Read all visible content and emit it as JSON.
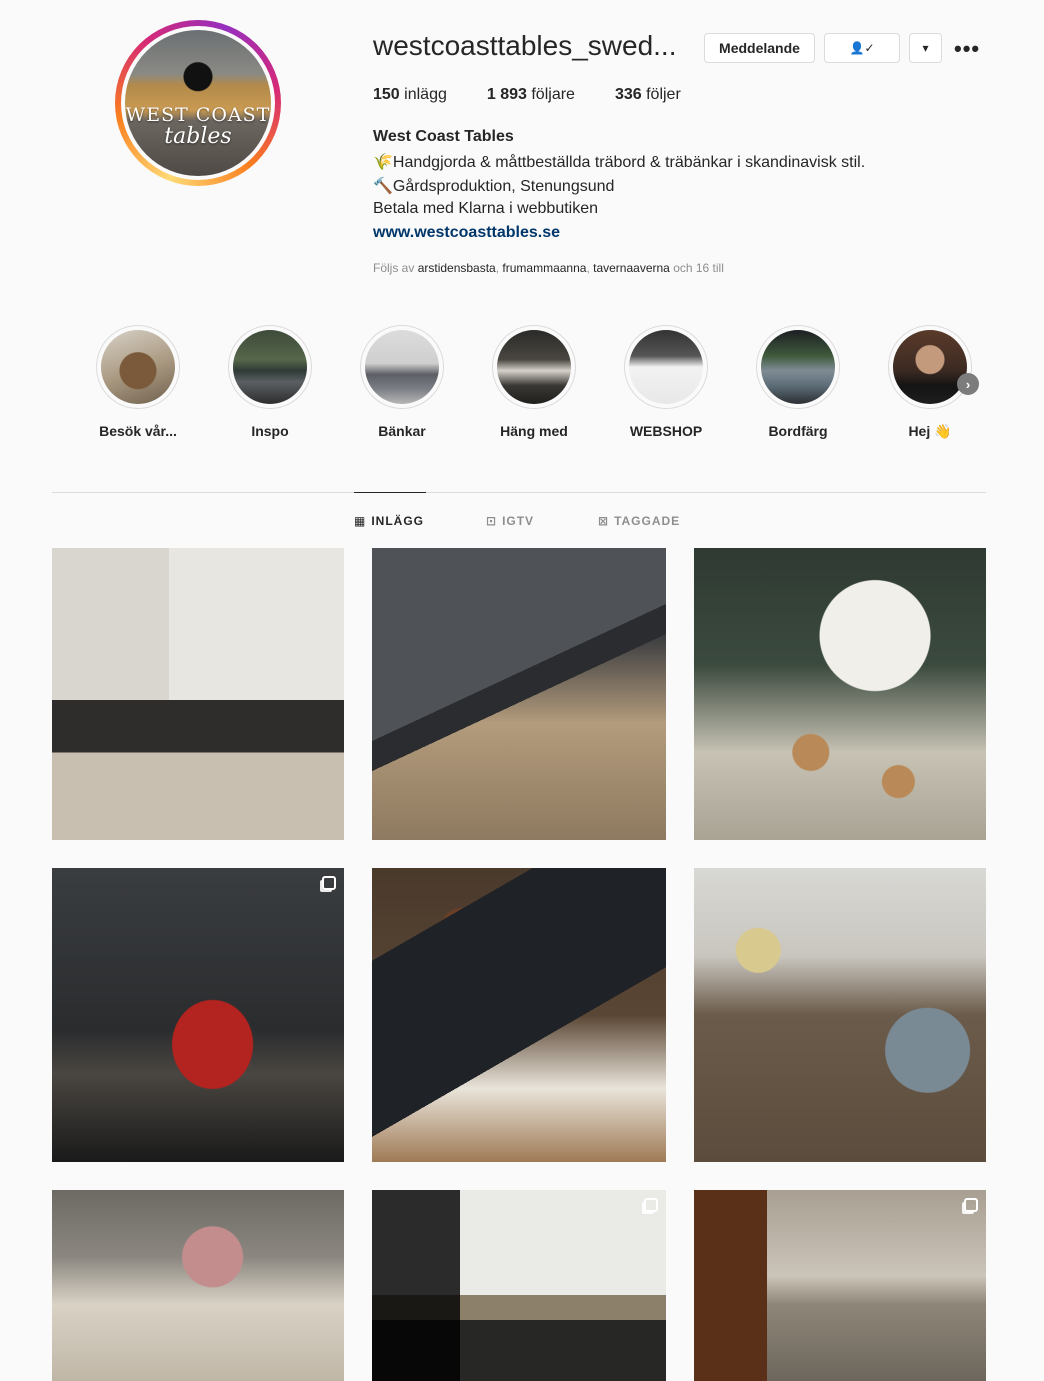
{
  "profile": {
    "username": "westcoasttables_swed...",
    "full_name": "West Coast Tables",
    "avatar_logo_top": "WEST COAST",
    "avatar_logo_script": "tables",
    "bio": [
      "🌾Handgjorda & måttbeställda träbord & träbänkar i skandinavisk stil.",
      "🔨Gårdsproduktion, Stenungsund",
      "Betala med Klarna i webbutiken"
    ],
    "website": "www.westcoasttables.se",
    "followed_by_prefix": "Följs av",
    "followed_by_users": [
      "arstidensbasta",
      "frumammaanna",
      "tavernaaverna"
    ],
    "followed_by_suffix": "och 16 till"
  },
  "header_buttons": {
    "message": "Meddelande",
    "following_icon": "👤✓",
    "dropdown_icon": "▾",
    "more_icon": "•••"
  },
  "stats": {
    "posts_value": "150",
    "posts_label": "inlägg",
    "followers_value": "1 893",
    "followers_label": "följare",
    "following_value": "336",
    "following_label": "följer"
  },
  "highlights": [
    {
      "label": "Besök vår...",
      "icon": "highlight-cover"
    },
    {
      "label": "Inspo",
      "icon": "highlight-cover"
    },
    {
      "label": "Bänkar",
      "icon": "highlight-cover"
    },
    {
      "label": "Häng med",
      "icon": "highlight-cover"
    },
    {
      "label": "WEBSHOP",
      "icon": "highlight-cover"
    },
    {
      "label": "Bordfärg",
      "icon": "highlight-cover"
    },
    {
      "label": "Hej 👋",
      "icon": "highlight-cover"
    }
  ],
  "highlights_next_icon": "›",
  "tabs": {
    "posts": {
      "label": "INLÄGG",
      "icon": "▦"
    },
    "igtv": {
      "label": "IGTV",
      "icon": "⊡"
    },
    "tagged": {
      "label": "TAGGADE",
      "icon": "⊠"
    }
  },
  "posts": [
    {
      "subject": "kitchen-table-scene",
      "multi": false
    },
    {
      "subject": "table-corner-logo",
      "multi": false
    },
    {
      "subject": "gingerbread-cookies",
      "multi": false
    },
    {
      "subject": "girl-with-dog",
      "multi": true
    },
    {
      "subject": "chocolate-tray",
      "multi": false
    },
    {
      "subject": "paper-stars",
      "multi": false
    },
    {
      "subject": "dining-room-flowers",
      "multi": false
    },
    {
      "subject": "bench-with-plate",
      "multi": true
    },
    {
      "subject": "table-with-chair",
      "multi": true
    }
  ]
}
